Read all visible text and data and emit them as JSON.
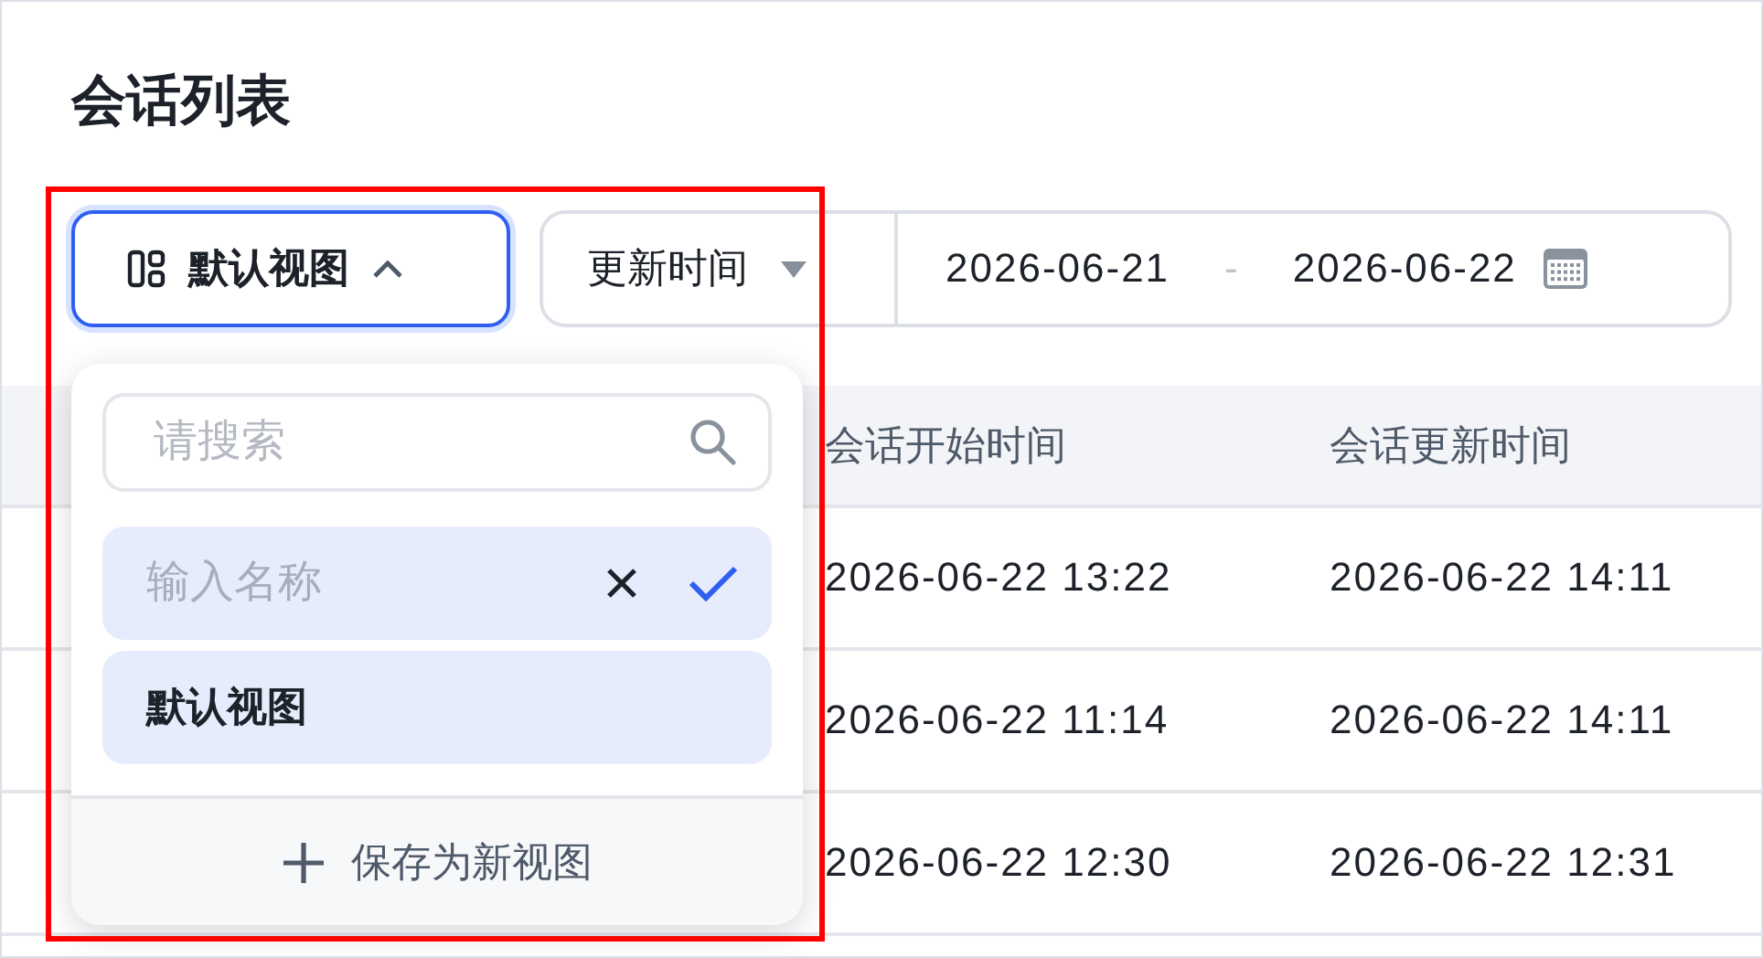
{
  "title": "会话列表",
  "toolbar": {
    "view_button": {
      "label": "默认视图",
      "expanded": true
    },
    "sort_select": {
      "label": "更新时间"
    },
    "date_range": {
      "start": "2026-06-21",
      "separator": "-",
      "end": "2026-06-22"
    }
  },
  "table": {
    "columns": [
      "会话开始时间",
      "会话更新时间"
    ],
    "rows": [
      [
        "2026-06-22 13:22",
        "2026-06-22 14:11"
      ],
      [
        "2026-06-22 11:14",
        "2026-06-22 14:11"
      ],
      [
        "2026-06-22 12:30",
        "2026-06-22 12:31"
      ]
    ]
  },
  "view_menu": {
    "search": {
      "placeholder": "请搜索"
    },
    "items": [
      {
        "kind": "edit",
        "placeholder": "输入名称"
      },
      {
        "kind": "option",
        "label": "默认视图",
        "selected": true
      }
    ],
    "footer_action": "保存为新视图"
  }
}
